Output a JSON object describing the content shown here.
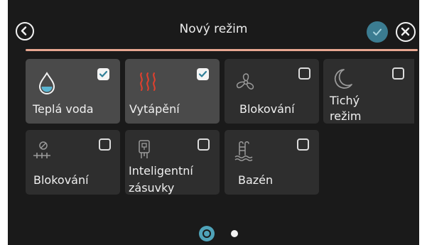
{
  "header": {
    "title": "Nový režim"
  },
  "colors": {
    "accent_line": "#e8a791",
    "confirm": "#3b7c91",
    "heating_icon": "#e0402e",
    "water_drop_fill": "#5ab4d0",
    "page_indicator_active": "#4fa3b9"
  },
  "tiles": [
    {
      "label": "Teplá voda",
      "icon": "water-drop-icon",
      "checked": true
    },
    {
      "label": "Vytápění",
      "icon": "heating-icon",
      "checked": true
    },
    {
      "label": "Blokování",
      "icon": "fan-icon",
      "checked": false
    },
    {
      "label_line1": "Tichý",
      "label_line2": "režim",
      "icon": "moon-icon",
      "checked": false
    },
    {
      "label": "Blokování",
      "icon": "blocked-heating-icon",
      "checked": false
    },
    {
      "label_line1": "Inteligentní",
      "label_line2": "zásuvky",
      "icon": "smart-plug-icon",
      "checked": false
    },
    {
      "label": "Bazén",
      "icon": "pool-icon",
      "checked": false
    }
  ],
  "pagination": {
    "current_page": 1,
    "page_count": 2
  }
}
